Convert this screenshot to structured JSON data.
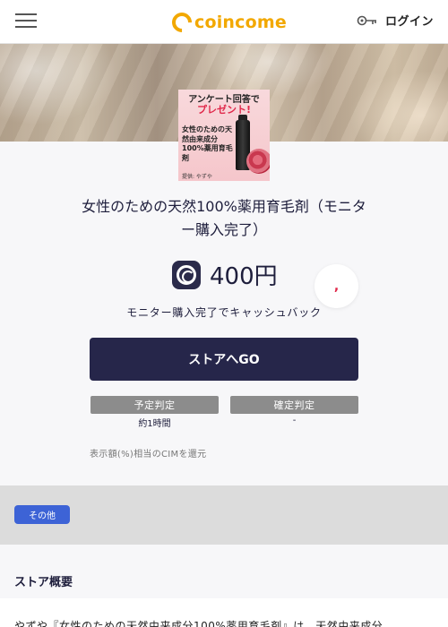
{
  "header": {
    "logo_text": "coincome",
    "login_label": "ログイン",
    "brand_color": "#f2a800",
    "icons": {
      "menu": "hamburger-menu-icon",
      "login": "key-icon"
    }
  },
  "product": {
    "image": {
      "line1": "アンケート回答で",
      "line2": "プレゼント!",
      "text": "女性のための天然由来成分100%薬用育毛剤",
      "provider": "提供: やずや"
    },
    "title": "女性のための天然100%薬用育毛剤（モニター購入完了）",
    "reward_value": "400円",
    "reward_condition": "モニター購入完了でキャッシュバック",
    "favorite_glyph": ","
  },
  "actions": {
    "store_button": "ストアへGO"
  },
  "judgement": {
    "scheduled_label": "予定判定",
    "scheduled_value": "約1時間",
    "confirmed_label": "確定判定",
    "confirmed_value": "-"
  },
  "note": "表示額(%)相当のCIMを還元",
  "category": {
    "tag": "その他",
    "color": "#3d63d6"
  },
  "overview": {
    "title": "ストア概要",
    "description": "やずや『女性のための天然由来成分100%薬用育毛剤』は、天然由来成分"
  },
  "colors": {
    "primary_dark": "#26264a",
    "judge_gray": "#8c8c8c"
  }
}
